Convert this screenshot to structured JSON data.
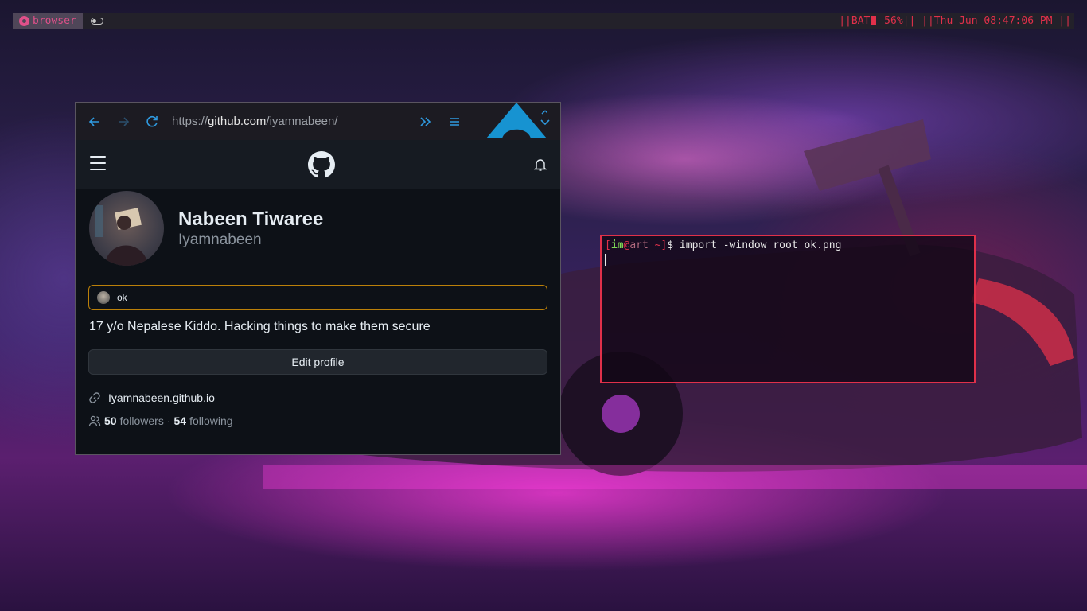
{
  "topbar": {
    "workspace_label": "browser",
    "status": "||BAT",
    "status_rest": " 56%|| ||Thu Jun 08:47:06 PM ||"
  },
  "browser": {
    "url_prefix": "https://",
    "url_host": "github.com",
    "url_path": "/iyamnabeen/"
  },
  "profile": {
    "full_name": "Nabeen Tiwaree",
    "username": "Iyamnabeen",
    "status_text": "ok",
    "bio": "17 y/o Nepalese Kiddo. Hacking things to make them secure",
    "edit_button": "Edit profile",
    "website": "Iyamnabeen.github.io",
    "followers_count": "50",
    "followers_label": "followers",
    "separator": "·",
    "following_count": "54",
    "following_label": "following"
  },
  "terminal": {
    "bracket_open": "[",
    "user": "im",
    "at": "@",
    "host": "art",
    "tilde": " ~",
    "bracket_close": "]",
    "command": "$ import -window root ok.png"
  },
  "colors": {
    "accent_red": "#e0304a",
    "link_blue": "#2f9ae0",
    "gh_bg": "#0d1117",
    "status_border": "#bb8009"
  },
  "icons": [
    "back-arrow-icon",
    "forward-arrow-icon",
    "reload-icon",
    "overflow-icon",
    "menu-icon",
    "arch-logo",
    "chevron-down-icon",
    "hamburger-icon",
    "github-logo",
    "bell-icon",
    "link-icon",
    "people-icon"
  ]
}
